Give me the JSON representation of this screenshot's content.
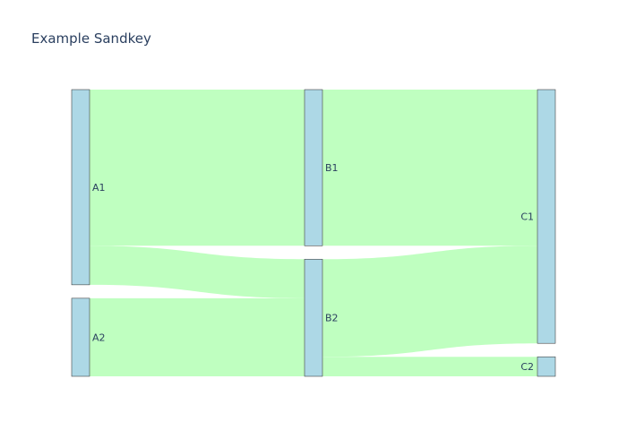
{
  "title": "Example Sandkey",
  "chart_data": {
    "type": "sankey",
    "nodes": [
      "A1",
      "A2",
      "B1",
      "B2",
      "C1",
      "C2"
    ],
    "links": [
      {
        "source": "A1",
        "target": "B1",
        "value": 8
      },
      {
        "source": "A1",
        "target": "B2",
        "value": 2
      },
      {
        "source": "A2",
        "target": "B2",
        "value": 4
      },
      {
        "source": "B1",
        "target": "C1",
        "value": 8
      },
      {
        "source": "B2",
        "target": "C1",
        "value": 5
      },
      {
        "source": "B2",
        "target": "C2",
        "value": 1
      }
    ],
    "node_color": "#add8e6",
    "link_color": "#bfffc0"
  }
}
